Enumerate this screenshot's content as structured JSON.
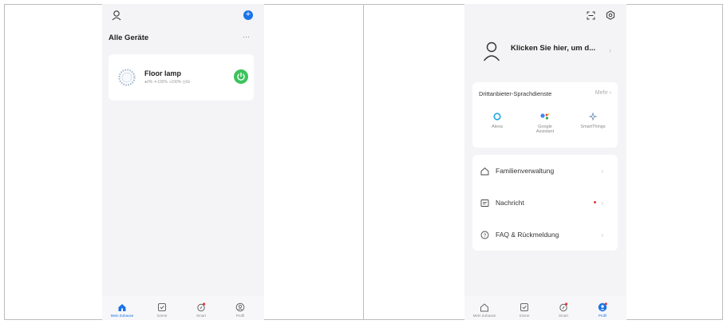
{
  "left": {
    "header_title": "Alle Geräte",
    "more_icon": "more-dots-icon",
    "device": {
      "name": "Floor lamp",
      "status_line": "●0% ☀100% ◑100% ◷0s"
    },
    "nav": [
      {
        "label": "Mein Zuhause",
        "active": true
      },
      {
        "label": "Szene",
        "active": false
      },
      {
        "label": "Smart",
        "active": false
      },
      {
        "label": "Profil",
        "active": false
      }
    ]
  },
  "right": {
    "login_text": "Klicken Sie hier, um d...",
    "voice_section": {
      "title": "Drittanbieter-Sprachdienste",
      "more": "Mehr",
      "items": [
        {
          "label": "Alexa"
        },
        {
          "label": "Google\nAssistant"
        },
        {
          "label": "SmartThings"
        }
      ]
    },
    "menu": [
      {
        "label": "Familienverwaltung"
      },
      {
        "label": "Nachricht"
      },
      {
        "label": "FAQ & Rückmeldung"
      }
    ],
    "nav": [
      {
        "label": "Mein Zuhause",
        "active": false
      },
      {
        "label": "Szene",
        "active": false
      },
      {
        "label": "Smart",
        "active": false
      },
      {
        "label": "Profil",
        "active": true
      }
    ]
  },
  "colors": {
    "accent": "#1a73e8",
    "power_green": "#3bc35c",
    "badge_red": "#e53935"
  }
}
